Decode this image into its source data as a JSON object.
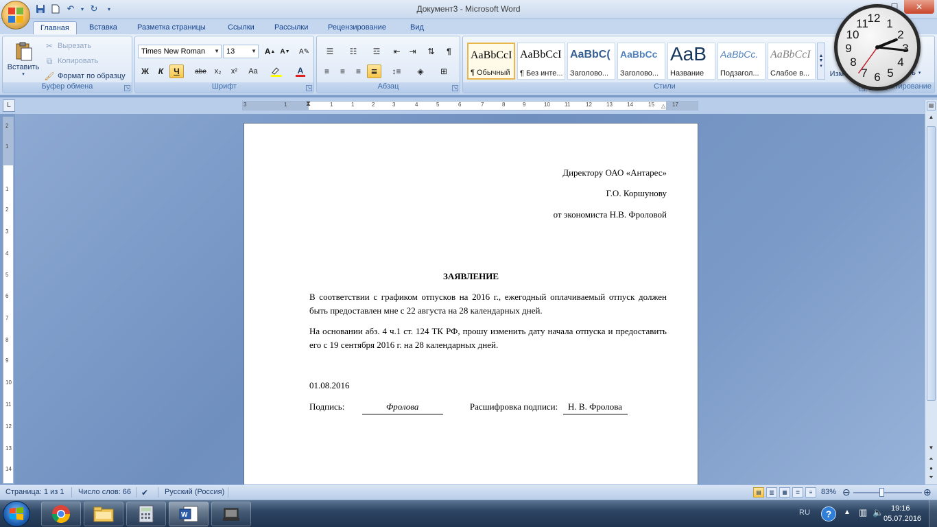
{
  "window": {
    "title": "Документ3 - Microsoft Word",
    "controls": [
      "minimize",
      "maximize",
      "close"
    ]
  },
  "qat": {
    "icons": [
      "save-icon",
      "new-doc-icon",
      "undo-icon",
      "redo-icon",
      "customize-icon"
    ]
  },
  "tabs": [
    {
      "label": "Главная",
      "active": true
    },
    {
      "label": "Вставка"
    },
    {
      "label": "Разметка страницы"
    },
    {
      "label": "Ссылки"
    },
    {
      "label": "Рассылки"
    },
    {
      "label": "Рецензирование"
    },
    {
      "label": "Вид"
    }
  ],
  "ribbon": {
    "clipboard": {
      "label": "Буфер обмена",
      "paste": "Вставить",
      "cut": "Вырезать",
      "copy": "Копировать",
      "format_painter": "Формат по образцу"
    },
    "font": {
      "label": "Шрифт",
      "font_name": "Times New Roman",
      "font_size": "13",
      "bold": "Ж",
      "italic": "К",
      "underline": "Ч",
      "strike": "abe",
      "subscript": "x₂",
      "superscript": "x²",
      "change_case": "Aa"
    },
    "paragraph": {
      "label": "Абзац"
    },
    "styles": {
      "label": "Стили",
      "items": [
        {
          "sample": "AaBbCcI",
          "name": "¶ Обычный",
          "selected": true
        },
        {
          "sample": "AaBbCcI",
          "name": "¶ Без инте..."
        },
        {
          "sample": "AaBbC(",
          "name": "Заголово..."
        },
        {
          "sample": "AaBbCc",
          "name": "Заголово..."
        },
        {
          "sample": "AaB",
          "name": "Название"
        },
        {
          "sample": "AaBbCc.",
          "name": "Подзагол..."
        },
        {
          "sample": "AaBbCcI",
          "name": "Слабое в..."
        }
      ],
      "change_styles": "Изм стил",
      "editing_partial": "ить",
      "editing_label": "дактирование"
    }
  },
  "ruler": {
    "h_numbers": [
      "3",
      "1",
      "2",
      "1",
      "1",
      "2",
      "3",
      "4",
      "5",
      "6",
      "7",
      "8",
      "9",
      "10",
      "11",
      "12",
      "13",
      "14",
      "15",
      "16",
      "17"
    ],
    "v_numbers": [
      "2",
      "1",
      "1",
      "1",
      "2",
      "3",
      "4",
      "5",
      "6",
      "7",
      "8",
      "9",
      "10",
      "11",
      "12",
      "13",
      "14"
    ]
  },
  "document": {
    "header_lines": [
      "Директору ОАО «Антарес»",
      "Г.О. Коршунову",
      "от экономиста Н.В. Фроловой"
    ],
    "title": "ЗАЯВЛЕНИЕ",
    "paragraph1": "В соответствии с графиком отпусков на 2016 г., ежегодный оплачиваемый отпуск должен быть предоставлен мне с 22 августа на 28 календарных дней.",
    "paragraph2": "На основании абз. 4 ч.1 ст. 124 ТК РФ, прошу изменить дату начала отпуска и предоставить его с 19 сентября 2016 г. на 28 календарных дней.",
    "date": "01.08.2016",
    "signature_label": "Подпись:",
    "signature_value": "Фролова",
    "decoding_label": "Расшифровка подписи:",
    "decoding_value": "Н. В. Фролова"
  },
  "status": {
    "page": "Страница: 1 из 1",
    "words": "Число слов: 66",
    "language": "Русский (Россия)",
    "zoom": "83%",
    "zoom_level": 0.83
  },
  "taskbar": {
    "apps": [
      "chrome-icon",
      "explorer-icon",
      "calculator-icon",
      "word-icon",
      "app-icon"
    ],
    "language": "RU",
    "time": "19:16",
    "date": "05.07.2016"
  },
  "clock": {
    "hour": 2,
    "minute": 16,
    "second": 36
  }
}
